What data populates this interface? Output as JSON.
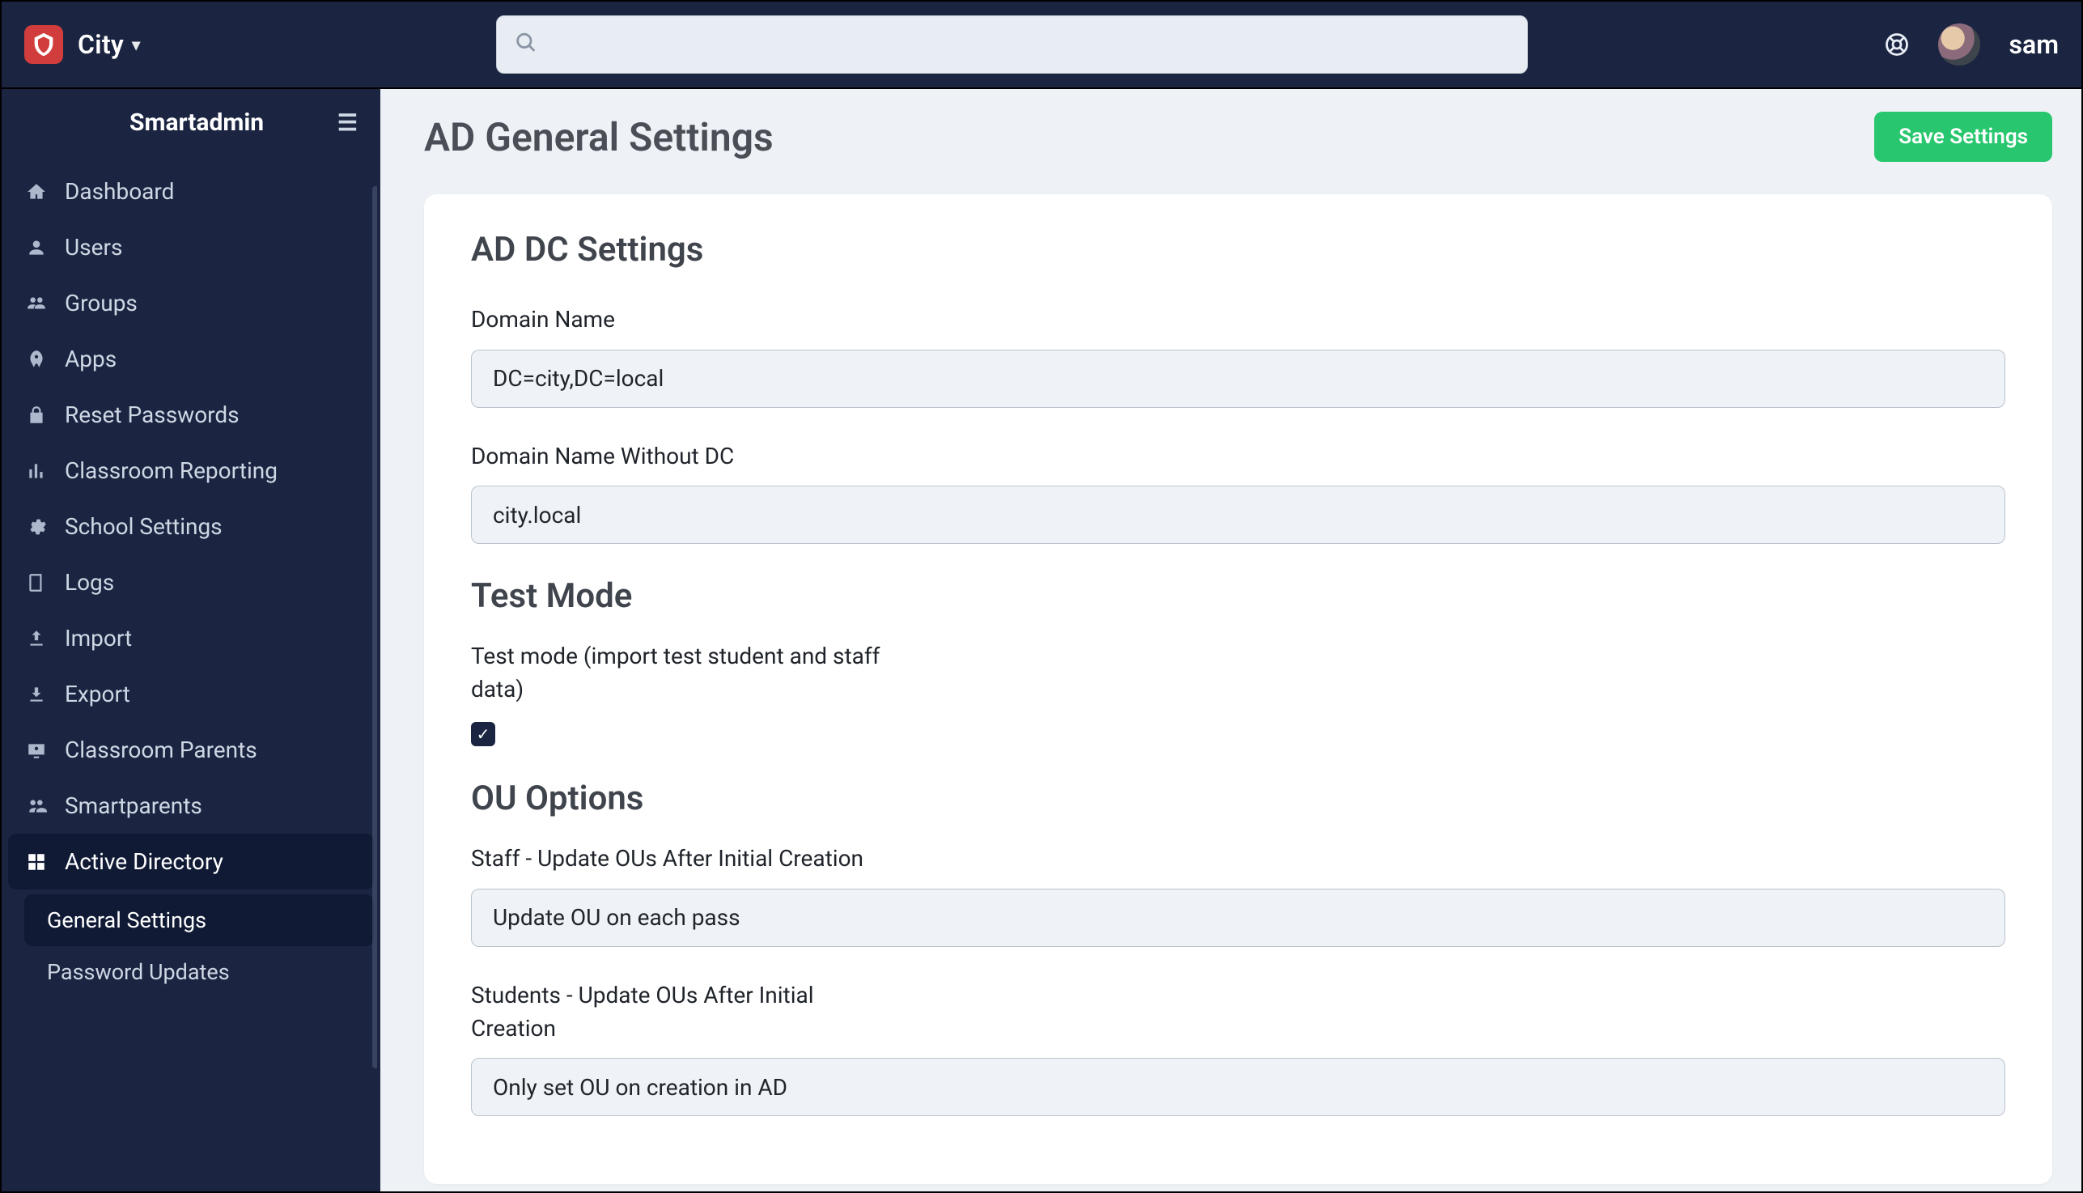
{
  "header": {
    "city_label": "City",
    "search_placeholder": "",
    "username": "sam"
  },
  "sidebar": {
    "brand": "Smartadmin",
    "items": [
      {
        "icon": "home",
        "label": "Dashboard"
      },
      {
        "icon": "user",
        "label": "Users"
      },
      {
        "icon": "group",
        "label": "Groups"
      },
      {
        "icon": "rocket",
        "label": "Apps"
      },
      {
        "icon": "lock",
        "label": "Reset Passwords"
      },
      {
        "icon": "chart",
        "label": "Classroom Reporting"
      },
      {
        "icon": "gear",
        "label": "School Settings"
      },
      {
        "icon": "book",
        "label": "Logs"
      },
      {
        "icon": "upload",
        "label": "Import"
      },
      {
        "icon": "download",
        "label": "Export"
      },
      {
        "icon": "classroom",
        "label": "Classroom Parents"
      },
      {
        "icon": "people",
        "label": "Smartparents"
      },
      {
        "icon": "grid",
        "label": "Active Directory",
        "active": true,
        "children": [
          {
            "label": "General Settings",
            "active": true
          },
          {
            "label": "Password Updates"
          }
        ]
      }
    ]
  },
  "page": {
    "title": "AD General Settings",
    "save_label": "Save Settings"
  },
  "form": {
    "dc_settings_title": "AD DC Settings",
    "domain_name_label": "Domain Name",
    "domain_name_value": "DC=city,DC=local",
    "domain_name_nodc_label": "Domain Name Without DC",
    "domain_name_nodc_value": "city.local",
    "testmode_title": "Test Mode",
    "testmode_label": "Test mode (import test student and staff data)",
    "testmode_checked": true,
    "ou_title": "OU Options",
    "staff_ou_label": "Staff - Update OUs After Initial Creation",
    "staff_ou_value": "Update OU on each pass",
    "students_ou_label": "Students - Update OUs After Initial Creation",
    "students_ou_value": "Only set OU on creation in AD"
  }
}
